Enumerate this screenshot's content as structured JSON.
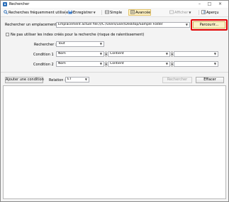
{
  "window": {
    "title": "Rechercher",
    "minimize": "–",
    "maximize": "□",
    "close": "×"
  },
  "toolbar": {
    "recent": "Recherches fréquemment utilisées",
    "save": "Enregistrer",
    "simple": "Simple",
    "advanced": "Avancée",
    "display": "Afficher",
    "preview": "Aperçu"
  },
  "location": {
    "label": "Rechercher un emplacement :",
    "value": "Emplacement actuel file:///C:/Users/user/Desktop/Sample Folder",
    "browse": "Parcourir..."
  },
  "no_index": {
    "label": "Ne pas utiliser les index créés pour la recherche (risque de ralentissement)"
  },
  "search_in": {
    "label": "Rechercher :",
    "value": "Tout"
  },
  "conditions": [
    {
      "label": "Condition 1",
      "field": "Nom",
      "operator": "Contient",
      "value": ""
    },
    {
      "label": "Condition 2",
      "field": "Nom",
      "operator": "Contient",
      "value": ""
    }
  ],
  "actions": {
    "add_condition": "Ajouter une condition",
    "relation_label": "Relation :",
    "relation_value": "ET",
    "search": "Rechercher",
    "clear": "Effacer"
  },
  "colors": {
    "highlight": "#e30000",
    "accent": "#2c6fb8"
  }
}
